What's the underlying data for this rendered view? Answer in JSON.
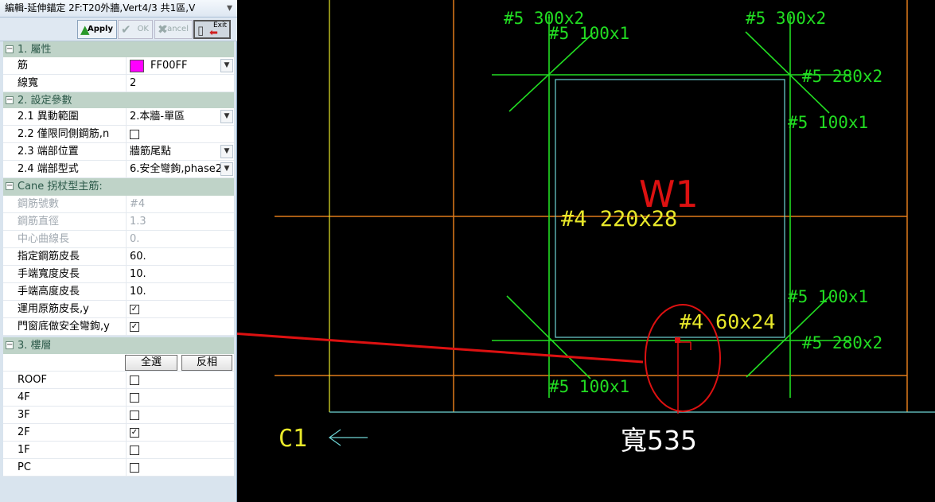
{
  "window": {
    "title": "編輯-延伸錨定 2F:T20外牆,Vert4/3 共1區,V",
    "close_glyph": "▾"
  },
  "toolbar": {
    "apply_label": "Apply",
    "ok_label": "OK",
    "cancel_label": "Cancel",
    "exit_label": "Exit"
  },
  "sections": {
    "attributes": "1. 屬性",
    "settings": "2. 設定參數",
    "cane": "Cane 拐杖型主筋:",
    "floors": "3. 樓層"
  },
  "props": {
    "rebar_label": "筋",
    "rebar_color_name": "FF00FF",
    "rebar_color": "#FF00FF",
    "linewidth_label": "線寬",
    "linewidth_value": "2",
    "range_label": "2.1 異動範圍",
    "range_value": "2.本牆-單區",
    "sameside_label": "2.2 僅限同側鋼筋,n",
    "endpos_label": "2.3 端部位置",
    "endpos_value": "牆筋尾點",
    "endtype_label": "2.4 端部型式",
    "endtype_value": "6.安全彎鉤,phase2",
    "barnum_label": "鋼筋號數",
    "barnum_value": "#4",
    "bardia_label": "鋼筋直徑",
    "bardia_value": "1.3",
    "centerlen_label": "中心曲線長",
    "centerlen_value": "0.",
    "cover_label": "指定鋼筋皮長",
    "cover_value": "60.",
    "handw_label": "手端寬度皮長",
    "handw_value": "10.",
    "handh_label": "手端高度皮長",
    "handh_value": "10.",
    "useorig_label": "運用原筋皮長,y",
    "doorbottom_label": "門窗底做安全彎鉤,y"
  },
  "floor_buttons": {
    "select_all": "全選",
    "invert": "反相"
  },
  "floors": [
    {
      "name": "ROOF",
      "checked": false
    },
    {
      "name": "4F",
      "checked": false
    },
    {
      "name": "3F",
      "checked": false
    },
    {
      "name": "2F",
      "checked": true
    },
    {
      "name": "1F",
      "checked": false
    },
    {
      "name": "PC",
      "checked": false
    }
  ],
  "cad": {
    "labels": {
      "tl_300": "#5 300x2",
      "tl_100": "#5 100x1",
      "tr_300": "#5 300x2",
      "r_280_top": "#5 280x2",
      "r_100_top": "#5 100x1",
      "wall_name": "W1",
      "main_bar": "#4 220x28",
      "r_100_bot": "#5 100x1",
      "hook": "#4 60x24",
      "r_280_bot": "#5 280x2",
      "bl_100": "#5 100x1",
      "column": "C1",
      "width": "寬535"
    },
    "colors": {
      "green": "#22dd22",
      "yellow": "#e8e82a",
      "orange": "#e07a1a",
      "cyan": "#6fd6d6",
      "red": "#dd1111",
      "white": "#ffffff"
    }
  }
}
